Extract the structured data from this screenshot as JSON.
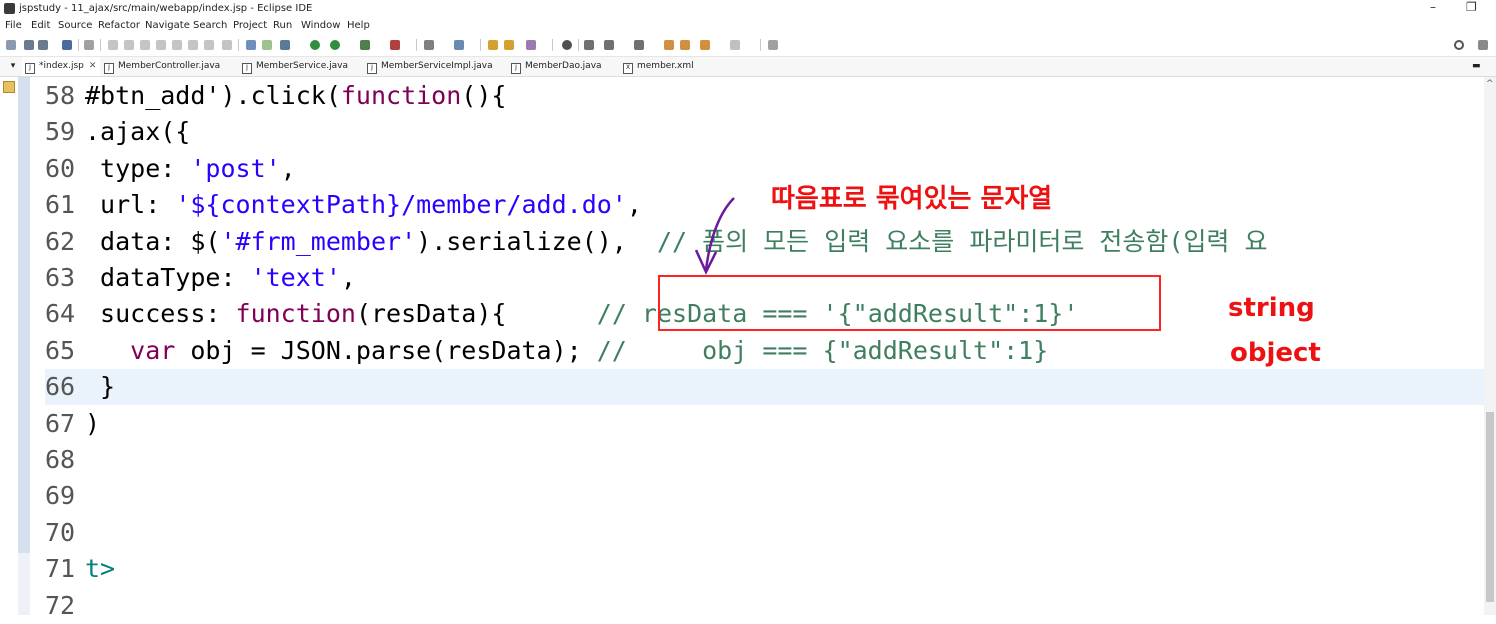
{
  "window": {
    "title": "jspstudy - 11_ajax/src/main/webapp/index.jsp - Eclipse IDE",
    "minimize": "–",
    "restore": "❐"
  },
  "menu": [
    "File",
    "Edit",
    "Source",
    "Refactor",
    "Navigate",
    "Search",
    "Project",
    "Run",
    "Window",
    "Help"
  ],
  "toolbar": {
    "search_icon": "search-icon"
  },
  "tabs": [
    {
      "label": "*index.jsp",
      "icon": "jsp-file-icon",
      "active": true,
      "close": "✕"
    },
    {
      "label": "MemberController.java",
      "icon": "java-file-icon"
    },
    {
      "label": "MemberService.java",
      "icon": "java-file-icon"
    },
    {
      "label": "MemberServiceImpl.java",
      "icon": "java-file-icon"
    },
    {
      "label": "MemberDao.java",
      "icon": "java-file-icon"
    },
    {
      "label": "member.xml",
      "icon": "xml-file-icon"
    }
  ],
  "code": {
    "lines": [
      {
        "num": "58",
        "parts": [
          {
            "t": "#btn_add').click(",
            "c": ""
          },
          {
            "t": "function",
            "c": "kw"
          },
          {
            "t": "(){",
            "c": ""
          }
        ]
      },
      {
        "num": "59",
        "parts": [
          {
            "t": ".ajax({",
            "c": ""
          }
        ]
      },
      {
        "num": "60",
        "parts": [
          {
            "t": " type: ",
            "c": ""
          },
          {
            "t": "'post'",
            "c": "str"
          },
          {
            "t": ",",
            "c": ""
          }
        ]
      },
      {
        "num": "61",
        "parts": [
          {
            "t": " url: ",
            "c": ""
          },
          {
            "t": "'${contextPath}/member/add.do'",
            "c": "str"
          },
          {
            "t": ",",
            "c": ""
          }
        ]
      },
      {
        "num": "62",
        "parts": [
          {
            "t": " data: $(",
            "c": ""
          },
          {
            "t": "'#frm_member'",
            "c": "str"
          },
          {
            "t": ").serialize(),  ",
            "c": ""
          },
          {
            "t": "// 폼의 모든 입력 요소를 파라미터로 전송함(입력 요",
            "c": "cm"
          }
        ]
      },
      {
        "num": "63",
        "parts": [
          {
            "t": " dataType: ",
            "c": ""
          },
          {
            "t": "'text'",
            "c": "str"
          },
          {
            "t": ",",
            "c": ""
          }
        ]
      },
      {
        "num": "64",
        "parts": [
          {
            "t": " success: ",
            "c": ""
          },
          {
            "t": "function",
            "c": "kw"
          },
          {
            "t": "(resData){      ",
            "c": ""
          },
          {
            "t": "// resData === '{\"addResult\":1}'",
            "c": "cm"
          }
        ]
      },
      {
        "num": "65",
        "parts": [
          {
            "t": "   ",
            "c": ""
          },
          {
            "t": "var",
            "c": "kw"
          },
          {
            "t": " obj = JSON.parse(resData); ",
            "c": ""
          },
          {
            "t": "//     obj === {\"addResult\":1}",
            "c": "cm"
          }
        ]
      },
      {
        "num": "66",
        "highlight": true,
        "parts": [
          {
            "t": " }",
            "c": ""
          }
        ]
      },
      {
        "num": "67",
        "parts": [
          {
            "t": ")",
            "c": ""
          }
        ]
      },
      {
        "num": "68",
        "parts": []
      },
      {
        "num": "69",
        "parts": []
      },
      {
        "num": "70",
        "parts": []
      },
      {
        "num": "71",
        "parts": [
          {
            "t": "t>",
            "c": "tag"
          }
        ]
      },
      {
        "num": "72",
        "parts": []
      }
    ]
  },
  "annotations": {
    "heading": "따음표로 묶여있는 문자열",
    "string_label": "string",
    "object_label": "object",
    "color": "#ee1111"
  }
}
